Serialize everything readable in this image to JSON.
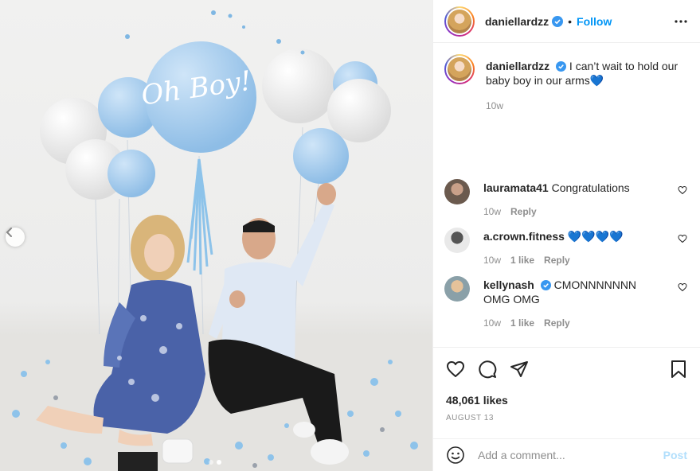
{
  "post": {
    "username": "daniellardzz",
    "follow_label": "Follow",
    "separator": "•",
    "caption_text": "I can’t wait to hold our baby boy in our arms💙",
    "caption_time": "10w",
    "balloon_text": "Oh Boy!",
    "likes": "48,061 likes",
    "date": "AUGUST 13"
  },
  "comments": [
    {
      "username": "lauramata41",
      "verified": false,
      "text": "Congratulations",
      "time": "10w",
      "likes": "",
      "reply": "Reply",
      "avatar_color": "#6b5a4e"
    },
    {
      "username": "a.crown.fitness",
      "verified": false,
      "text": "💙💙💙💙",
      "time": "10w",
      "likes": "1 like",
      "reply": "Reply",
      "avatar_color": "#3a3a3a"
    },
    {
      "username": "kellynash",
      "verified": true,
      "text": "CMONNNNNNN OMG OMG",
      "time": "10w",
      "likes": "1 like",
      "reply": "Reply",
      "avatar_color": "#8aa0a8"
    }
  ],
  "add_comment": {
    "placeholder": "Add a comment...",
    "post_label": "Post"
  },
  "icons": {
    "like": "heart-icon",
    "comment": "comment-icon",
    "share": "share-icon",
    "save": "bookmark-icon",
    "more": "more-options-icon",
    "emoji": "emoji-icon",
    "prev": "chevron-left-icon"
  },
  "colors": {
    "link_blue": "#0095f6",
    "post_disabled": "#b2dffc",
    "verified": "#3897f0",
    "balloon_blue": "#a8cdee"
  }
}
